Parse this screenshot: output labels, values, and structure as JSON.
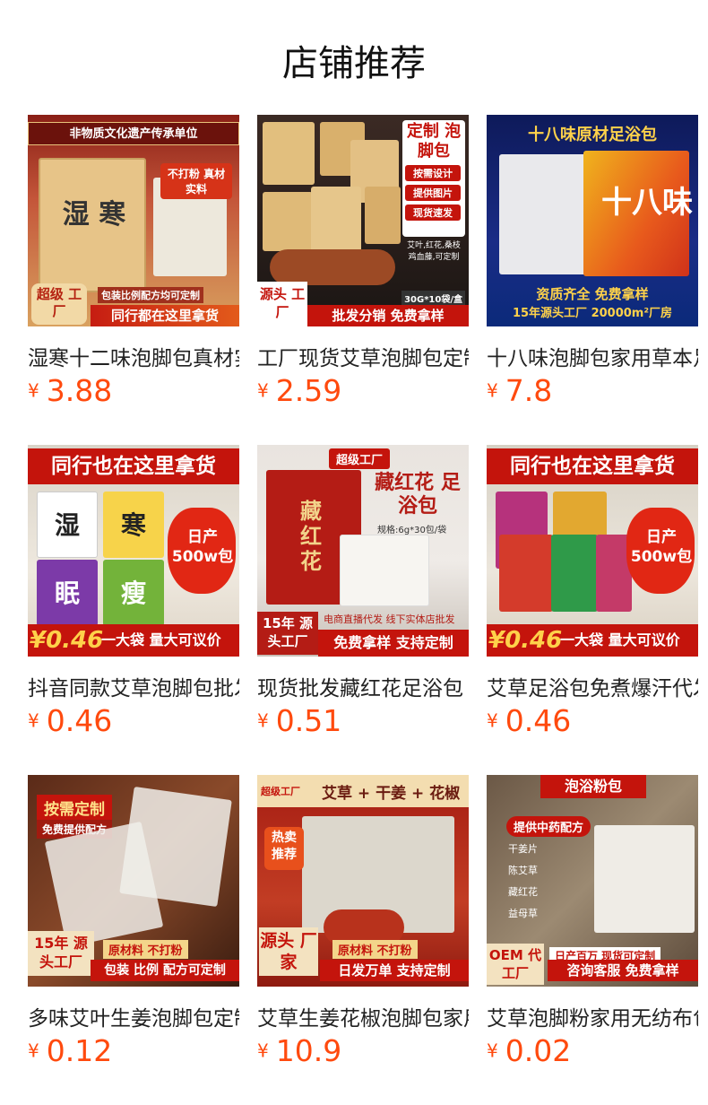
{
  "section": {
    "title": "店铺推荐"
  },
  "colors": {
    "price": "#ff4a0e",
    "title": "#111111"
  },
  "products": [
    {
      "name": "湿寒十二味泡脚包真材实料",
      "currency": "¥",
      "price": "3.88",
      "image": {
        "top_banner": "非物质文化遗产传承单位",
        "pack_text": "湿 寒",
        "badge": "不打粉 真材实料",
        "tag": "包装比例配方均可定制",
        "corner": "超级 工厂",
        "bottom_banner": "同行都在这里拿货"
      }
    },
    {
      "name": "工厂现货艾草泡脚包定制",
      "currency": "¥",
      "price": "2.59",
      "image": {
        "side_title": "定制 泡脚包",
        "features": [
          "按需设计",
          "提供图片",
          "现货速发"
        ],
        "note": "艾叶,红花,桑枝 鸡血藤,可定制",
        "spec": "30G*10袋/盒",
        "corner": "源头 工厂",
        "bottom_banner": "批发分销 免费拿样"
      }
    },
    {
      "name": "十八味泡脚包家用草本足浴包",
      "currency": "¥",
      "price": "7.8",
      "image": {
        "top_banner": "十八味原材足浴包",
        "pack_text": "十八味",
        "line1": "资质齐全 免费拿样",
        "line2": "15年源头工厂  20000m²厂房"
      }
    },
    {
      "name": "抖音同款艾草泡脚包批发",
      "currency": "¥",
      "price": "0.46",
      "image": {
        "top_banner": "同行也在这里拿货",
        "packs": [
          "湿",
          "寒",
          "眠",
          "瘦"
        ],
        "burst": "日产 500w包",
        "bottom_price": "¥0.46",
        "bottom_text": "一大袋 量大可议价"
      }
    },
    {
      "name": "现货批发藏红花足浴包",
      "currency": "¥",
      "price": "0.51",
      "image": {
        "top_badge": "超级工厂",
        "title": "藏红花 足浴包",
        "spec": "规格:6g*30包/袋",
        "pack_text": "藏红花",
        "corner": "15年 源头工厂",
        "line1": "电商直播代发  线下实体店批发",
        "line2": "免费拿样 支持定制"
      }
    },
    {
      "name": "艾草足浴包免煮爆汗代发",
      "currency": "¥",
      "price": "0.46",
      "image": {
        "top_banner": "同行也在这里拿货",
        "burst": "日产 500w包",
        "bottom_price": "¥0.46",
        "bottom_text": "一大袋 量大可议价"
      }
    },
    {
      "name": "多味艾叶生姜泡脚包定制",
      "currency": "¥",
      "price": "0.12",
      "image": {
        "top_banner": "按需定制",
        "sub_banner": "免费提供配方",
        "corner": "15年 源头工厂",
        "tag1": "原材料 不打粉",
        "tag2": "包装 比例 配方可定制"
      }
    },
    {
      "name": "艾草生姜花椒泡脚包家用",
      "currency": "¥",
      "price": "10.9",
      "image": {
        "top_badge": "超级工厂",
        "top_title": "艾草 + 干姜 + 花椒",
        "hot": "热卖 推荐",
        "corner": "源头 厂家",
        "tag1": "原材料 不打粉",
        "tag2": "日发万单 支持定制"
      }
    },
    {
      "name": "艾草泡脚粉家用无纺布包",
      "currency": "¥",
      "price": "0.02",
      "image": {
        "top_banner": "泡浴粉包",
        "sub_banner": "提供中药配方",
        "list": [
          "干姜片",
          "陈艾草",
          "藏红花",
          "益母草"
        ],
        "corner": "OEM 代工厂",
        "line1": "日产百万  现货可定制",
        "line2": "咨询客服 免费拿样"
      }
    }
  ]
}
